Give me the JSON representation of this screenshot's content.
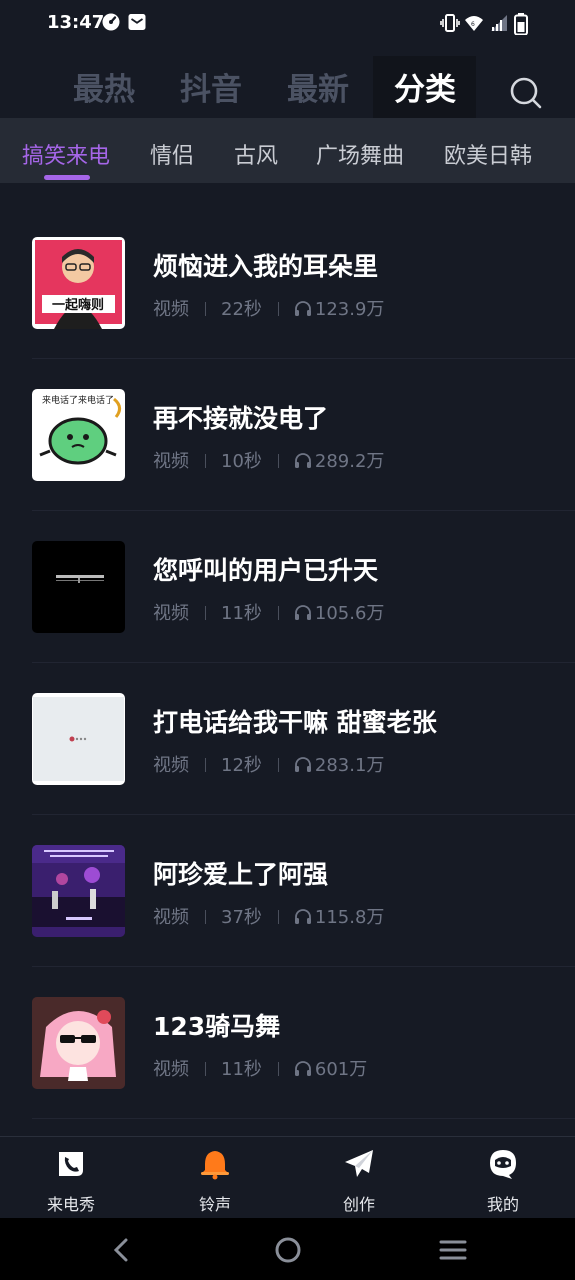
{
  "status_bar": {
    "time": "13:47",
    "left_icons": [
      "speed-dial-icon",
      "mail-icon"
    ],
    "right_icons": [
      "vibrate-icon",
      "wifi-icon",
      "signal-icon",
      "battery-icon"
    ]
  },
  "top_tabs": {
    "items": [
      {
        "label": "最热",
        "active": false
      },
      {
        "label": "抖音",
        "active": false
      },
      {
        "label": "最新",
        "active": false
      },
      {
        "label": "分类",
        "active": true
      }
    ],
    "search_icon": "search-icon"
  },
  "sub_tabs": {
    "items": [
      {
        "label": "搞笑来电",
        "active": true
      },
      {
        "label": "情侣",
        "active": false
      },
      {
        "label": "古风",
        "active": false
      },
      {
        "label": "广场舞曲",
        "active": false
      },
      {
        "label": "欧美日韩",
        "active": false
      }
    ],
    "active_color": "#a566e8"
  },
  "items": [
    {
      "title": "烦恼进入我的耳朵里",
      "type": "视频",
      "duration": "22秒",
      "plays": "123.9万",
      "thumb_text": "一起嗨则"
    },
    {
      "title": "再不接就没电了",
      "type": "视频",
      "duration": "10秒",
      "plays": "289.2万",
      "thumb_text": "来电话了来电话了"
    },
    {
      "title": "您呼叫的用户已升天",
      "type": "视频",
      "duration": "11秒",
      "plays": "105.6万",
      "thumb_text": ""
    },
    {
      "title": "打电话给我干嘛 甜蜜老张",
      "type": "视频",
      "duration": "12秒",
      "plays": "283.1万",
      "thumb_text": ""
    },
    {
      "title": "阿珍爱上了阿强",
      "type": "视频",
      "duration": "37秒",
      "plays": "115.8万",
      "thumb_text": ""
    },
    {
      "title": "123骑马舞",
      "type": "视频",
      "duration": "11秒",
      "plays": "601万",
      "thumb_text": ""
    }
  ],
  "bottom_nav": [
    {
      "label": "来电秀",
      "icon": "phone-icon"
    },
    {
      "label": "铃声",
      "icon": "bell-icon"
    },
    {
      "label": "创作",
      "icon": "paper-plane-icon"
    },
    {
      "label": "我的",
      "icon": "profile-icon"
    }
  ],
  "colors": {
    "background": "#161a24",
    "sub_tab_bar": "#262b35",
    "accent": "#a566e8",
    "bell_orange": "#ff7a1a"
  }
}
